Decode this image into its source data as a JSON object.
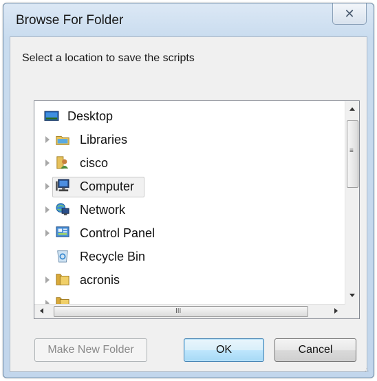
{
  "dialog": {
    "title": "Browse For Folder",
    "close_glyph": "✕",
    "prompt": "Select a location to save the scripts"
  },
  "tree": {
    "items": [
      {
        "label": "Desktop",
        "icon": "desktop-icon",
        "expandable": false
      },
      {
        "label": "Libraries",
        "icon": "libraries-icon",
        "expandable": true
      },
      {
        "label": "cisco",
        "icon": "user-folder-icon",
        "expandable": true
      },
      {
        "label": "Computer",
        "icon": "computer-icon",
        "expandable": true,
        "selected": true
      },
      {
        "label": "Network",
        "icon": "network-icon",
        "expandable": true
      },
      {
        "label": "Control Panel",
        "icon": "control-panel-icon",
        "expandable": true
      },
      {
        "label": "Recycle Bin",
        "icon": "recycle-bin-icon",
        "expandable": false
      },
      {
        "label": "acronis",
        "icon": "folder-icon",
        "expandable": true
      }
    ]
  },
  "buttons": {
    "make_new_folder": "Make New Folder",
    "ok": "OK",
    "cancel": "Cancel"
  },
  "scrollbar": {
    "h_grip": "III",
    "v_grip": "≡"
  }
}
